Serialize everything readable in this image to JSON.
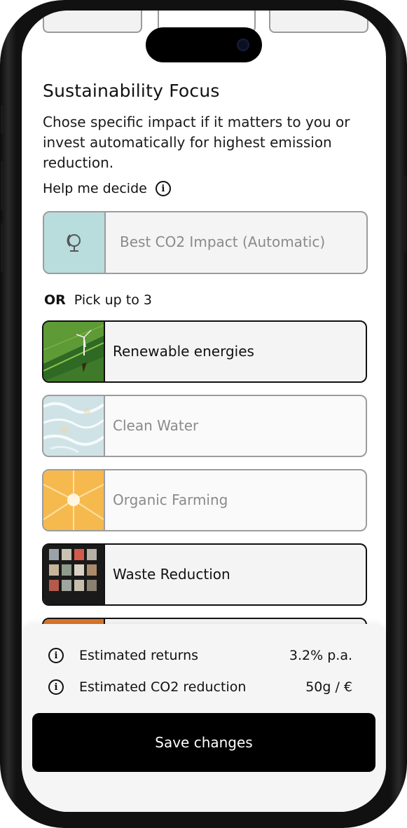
{
  "page": {
    "title": "Sustainability Focus",
    "description": "Chose specific impact if it matters to you or invest automatically for highest emission reduction.",
    "help_label": "Help me decide"
  },
  "auto_option": {
    "label": "Best CO2 Impact (Automatic)",
    "icon": "globe-icon",
    "selected": false
  },
  "or_row": {
    "or_label": "OR",
    "pick_label": "Pick up to 3"
  },
  "options": [
    {
      "label": "Renewable energies",
      "selected": true,
      "image": "wind-turbine-field"
    },
    {
      "label": "Clean Water",
      "selected": false,
      "image": "water-surface"
    },
    {
      "label": "Organic Farming",
      "selected": false,
      "image": "orange-slice"
    },
    {
      "label": "Waste Reduction",
      "selected": true,
      "image": "plastic-waste-shelves"
    }
  ],
  "summary": {
    "returns_label": "Estimated returns",
    "returns_value": "3.2% p.a.",
    "co2_label": "Estimated CO2 reduction",
    "co2_value": "50g / €"
  },
  "save_label": "Save changes",
  "colors": {
    "accent": "#000000",
    "auto_thumb": "#b9dcdc",
    "unselected_text": "#8a8a8a"
  }
}
